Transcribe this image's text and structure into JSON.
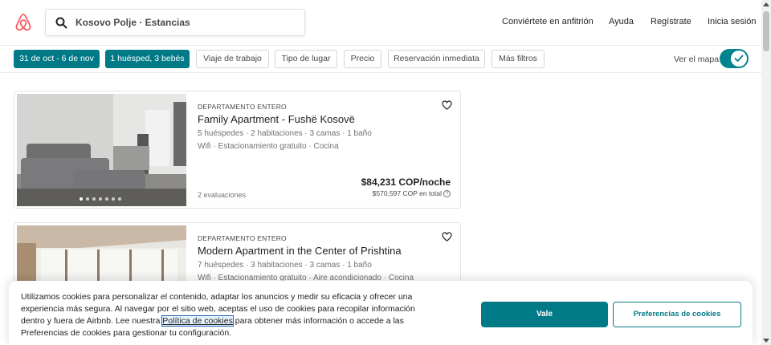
{
  "header": {
    "search_value": "Kosovo Polje · Estancias",
    "nav": [
      "Conviértete en anfitrión",
      "Ayuda",
      "Regístrate",
      "Inicia sesión"
    ]
  },
  "filters": {
    "dates": "31 de oct - 6 de nov",
    "guests": "1 huésped, 3 bebés",
    "work_trip": "Viaje de trabajo",
    "place_type": "Tipo de lugar",
    "price": "Precio",
    "instant_book": "Reservación inmediata",
    "more": "Más filtros",
    "map_label": "Ver el mapa",
    "map_toggle_on": true
  },
  "listings": [
    {
      "type": "DEPARTAMENTO ENTERO",
      "title": "Family Apartment - Fushë Kosovë",
      "details": "5 huéspedes · 2 habitaciones · 3 camas · 1 baño",
      "amenities": "Wifi · Estacionamiento gratuito · Cocina",
      "reviews": "2 evaluaciones",
      "price": "$84,231 COP/noche",
      "total": "$570,597 COP en total"
    },
    {
      "type": "DEPARTAMENTO ENTERO",
      "title": "Modern Apartment in the Center of Prishtina",
      "details": "7 huéspedes · 3 habitaciones · 3 camas · 1 baño",
      "amenities": "Wifi · Estacionamiento gratuito · Aire acondicionado · Cocina"
    }
  ],
  "cookie": {
    "text_before": "Utilizamos cookies para personalizar el contenido, adaptar los anuncios y medir su eficacia y ofrecer una experiencia más segura. Al navegar por el sitio web, aceptas el uso de cookies para recopilar información dentro y fuera de Airbnb. Lee nuestra ",
    "link": "Política de cookies",
    "text_after": " para obtener más información o accede a las Preferencias de cookies para gestionar tu configuración.",
    "accept": "Vale",
    "preferences": "Preferencias de cookies"
  },
  "colors": {
    "brand": "#FF5A5F",
    "accent": "#007A87"
  }
}
